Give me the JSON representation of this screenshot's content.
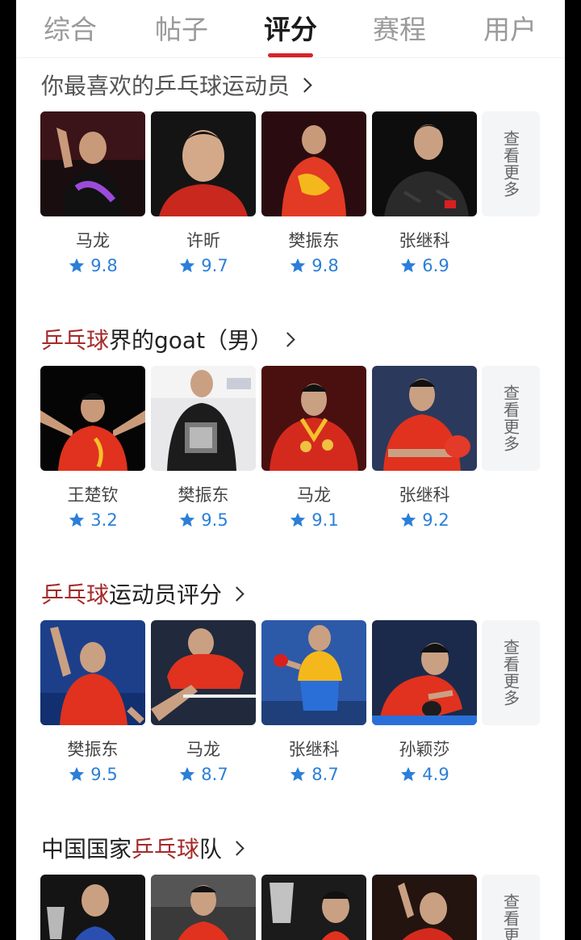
{
  "tabs": [
    "综合",
    "帖子",
    "评分",
    "赛程",
    "用户"
  ],
  "active_tab_index": 2,
  "more_label": "查看更多",
  "accent_color": "#d8232a",
  "rating_color": "#2b7fd8",
  "sections": [
    {
      "title_highlight": "",
      "title_plain": "你最喜欢的乒乓球运动员",
      "title_suffix": "",
      "players": [
        {
          "name": "马龙",
          "rating": "9.8"
        },
        {
          "name": "许昕",
          "rating": "9.7"
        },
        {
          "name": "樊振东",
          "rating": "9.8"
        },
        {
          "name": "张继科",
          "rating": "6.9"
        }
      ]
    },
    {
      "title_highlight": "乒乓球",
      "title_plain": "界的goat（男）",
      "title_suffix": "",
      "players": [
        {
          "name": "王楚钦",
          "rating": "3.2"
        },
        {
          "name": "樊振东",
          "rating": "9.5"
        },
        {
          "name": "马龙",
          "rating": "9.1"
        },
        {
          "name": "张继科",
          "rating": "9.2"
        }
      ]
    },
    {
      "title_highlight": "乒乓球",
      "title_plain": "运动员评分",
      "title_suffix": "",
      "players": [
        {
          "name": "樊振东",
          "rating": "9.5"
        },
        {
          "name": "马龙",
          "rating": "8.7"
        },
        {
          "name": "张继科",
          "rating": "8.7"
        },
        {
          "name": "孙颖莎",
          "rating": "4.9"
        }
      ]
    },
    {
      "title_prefix": "中国国家",
      "title_highlight": "乒乓球",
      "title_plain": "队",
      "players": []
    }
  ]
}
